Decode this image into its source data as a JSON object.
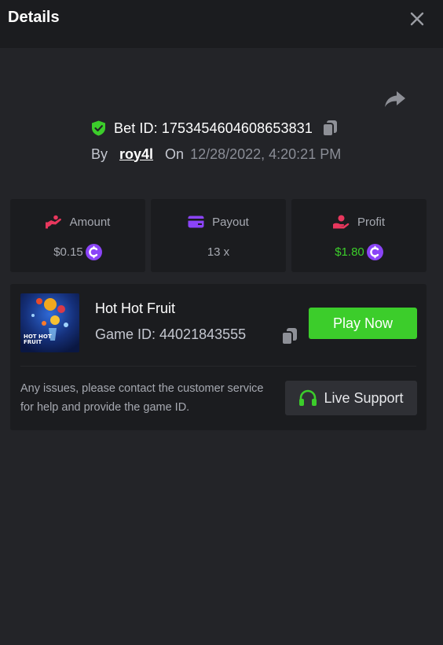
{
  "header": {
    "title": "Details"
  },
  "bet": {
    "id_text": "Bet ID: 1753454604608653831",
    "by_label": "By",
    "username": "roy4l",
    "on_label": "On",
    "datetime": "12/28/2022, 4:20:21 PM"
  },
  "stats": [
    {
      "label": "Amount",
      "value": "$0.15",
      "icon": "amount-icon",
      "color": "#e8375d"
    },
    {
      "label": "Payout",
      "value": "13 x",
      "icon": "card-icon",
      "color": "#8b44f7"
    },
    {
      "label": "Profit",
      "value": "$1.80",
      "icon": "profit-icon",
      "color": "#e8375d"
    }
  ],
  "game": {
    "name": "Hot Hot Fruit",
    "id_text": "Game ID: 44021843555",
    "thumb_text_1": "HOT HOT",
    "thumb_text_2": "FRUIT",
    "play_label": "Play Now"
  },
  "support": {
    "text": "Any issues, please contact the customer service for help and provide the game ID.",
    "button_label": "Live Support"
  },
  "colors": {
    "accent_green": "#3ccd2b",
    "coin_purple": "#8b44f7",
    "background": "#232428",
    "card": "#1b1c1f"
  }
}
